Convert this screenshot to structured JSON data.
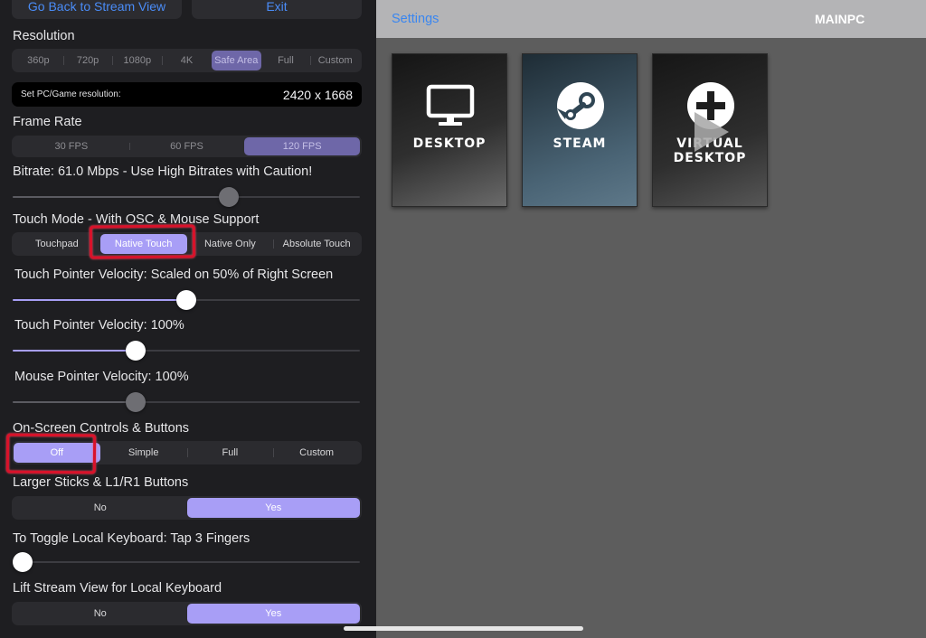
{
  "top_buttons": {
    "back_label": "Go Back to Stream View",
    "exit_label": "Exit"
  },
  "resolution": {
    "label": "Resolution",
    "options": [
      "360p",
      "720p",
      "1080p",
      "4K",
      "Safe Area",
      "Full",
      "Custom"
    ],
    "selected": "Safe Area",
    "set_label": "Set PC/Game resolution:",
    "value": "2420 x 1668"
  },
  "frame_rate": {
    "label": "Frame Rate",
    "options": [
      "30 FPS",
      "60 FPS",
      "120 FPS"
    ],
    "selected": "120 FPS"
  },
  "bitrate": {
    "label": "Bitrate: 61.0 Mbps - Use High Bitrates with Caution!",
    "level": 0.63
  },
  "touch_mode": {
    "label": "Touch Mode - With OSC & Mouse Support",
    "options": [
      "Touchpad",
      "Native Touch",
      "Native Only",
      "Absolute Touch"
    ],
    "selected": "Native Touch"
  },
  "touch_pointer_scaled": {
    "label": "Touch Pointer Velocity: Scaled on 50% of Right Screen",
    "level": 0.5
  },
  "touch_pointer": {
    "label": "Touch Pointer Velocity: 100%",
    "level": 0.345
  },
  "mouse_pointer": {
    "label": "Mouse Pointer Velocity: 100%",
    "level": 0.345
  },
  "osc": {
    "label": "On-Screen Controls & Buttons",
    "options": [
      "Off",
      "Simple",
      "Full",
      "Custom"
    ],
    "selected": "Off"
  },
  "larger_sticks": {
    "label": "Larger Sticks & L1/R1 Buttons",
    "options": [
      "No",
      "Yes"
    ],
    "selected": "Yes"
  },
  "keyboard_toggle": {
    "label": "To Toggle Local Keyboard: Tap 3 Fingers",
    "level": 0.0
  },
  "lift_stream": {
    "label": "Lift Stream View for Local Keyboard",
    "options": [
      "No",
      "Yes"
    ],
    "selected": "Yes"
  },
  "nav": {
    "settings_label": "Settings",
    "title": "MAINPC"
  },
  "apps": [
    {
      "label": "DESKTOP",
      "icon": "monitor-icon"
    },
    {
      "label": "STEAM",
      "icon": "steam-icon"
    },
    {
      "label_line1": "VIRTUAL",
      "label_line2": "DESKTOP",
      "icon": "plus-circle-icon",
      "overlay_icon": "play-icon"
    }
  ],
  "colors": {
    "accent": "#a89ef6",
    "link": "#3a86f0",
    "highlight_mark": "#d9122a"
  }
}
